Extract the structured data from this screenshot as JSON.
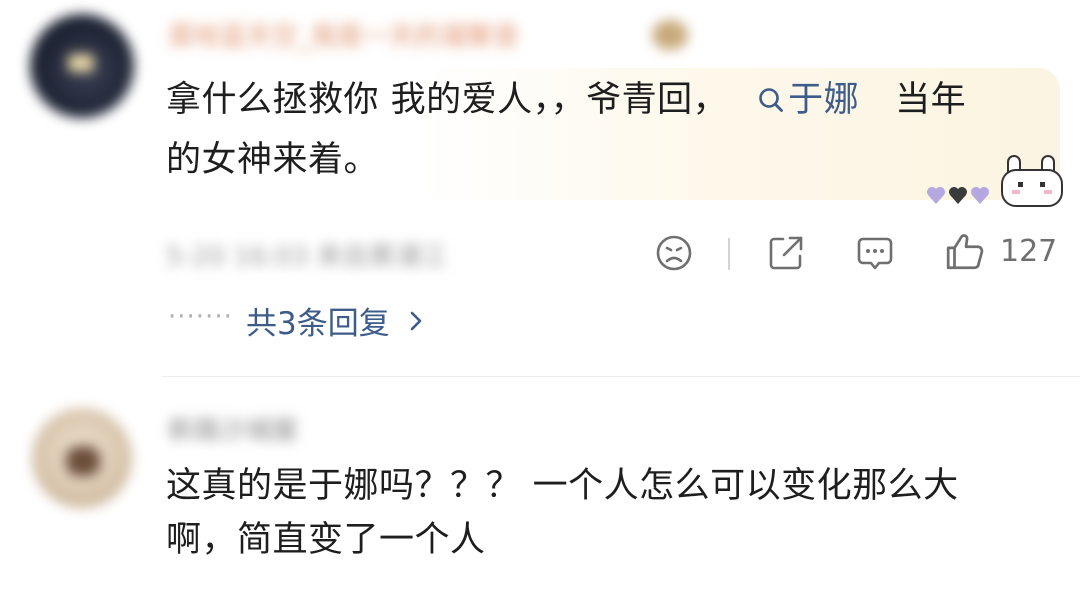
{
  "comments": [
    {
      "username": "菜哈蓝天空_我是一天的凝聚音",
      "text_part1": "拿什么拯救你 我的爱人，，爷青回，",
      "mention_icon": "search-icon",
      "mention": "于娜",
      "text_part2": "当年",
      "text_line2": "的女神来着。",
      "meta": "5-20 16:03 来自黄浦江",
      "like_count": "127",
      "replies_label": "共3条回复",
      "replies_dots": "·······"
    },
    {
      "username": "新路沙城屋",
      "text_line1": "这真的是于娜吗？？？ 一个人怎么可以变化那么大",
      "text_line2": "啊，简直变了一个人"
    }
  ],
  "colors": {
    "link": "#3e5c8a",
    "text": "#1e1e1e",
    "meta": "#9a9a9a",
    "icon": "#6f6f6f",
    "card_bg": "#fdf8ea"
  }
}
